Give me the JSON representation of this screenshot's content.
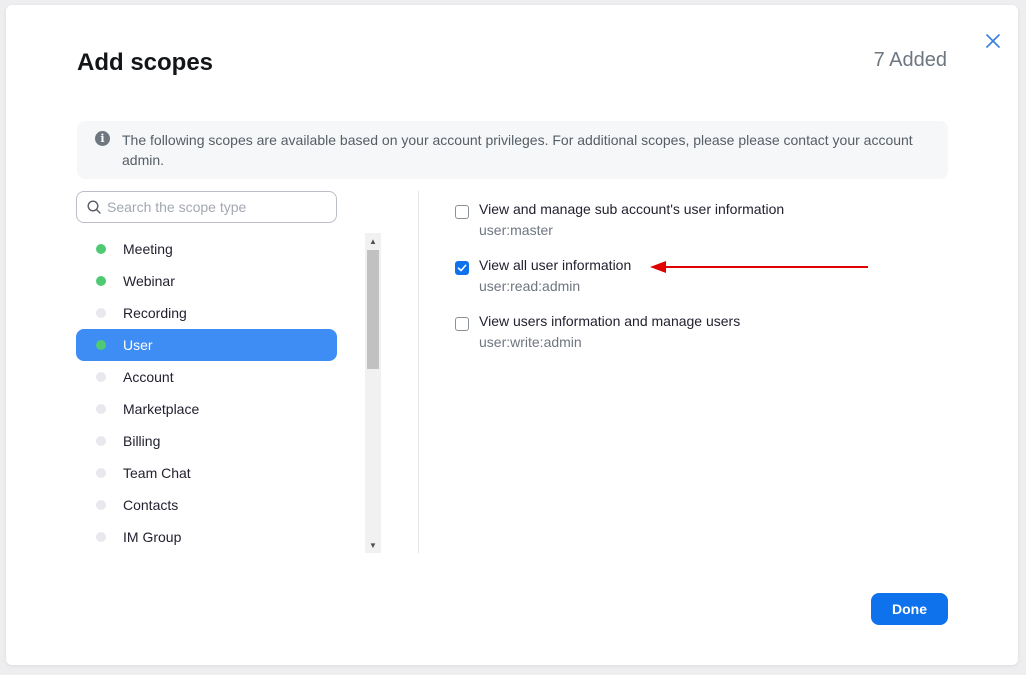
{
  "dialog": {
    "title": "Add scopes",
    "added_count": "7 Added",
    "info_text": "The following scopes are available based on your account privileges. For additional scopes, please please contact your account admin.",
    "search_placeholder": "Search the scope type",
    "done_label": "Done"
  },
  "categories": [
    {
      "label": "Meeting",
      "has_scopes": true,
      "active": false
    },
    {
      "label": "Webinar",
      "has_scopes": true,
      "active": false
    },
    {
      "label": "Recording",
      "has_scopes": false,
      "active": false
    },
    {
      "label": "User",
      "has_scopes": true,
      "active": true
    },
    {
      "label": "Account",
      "has_scopes": false,
      "active": false
    },
    {
      "label": "Marketplace",
      "has_scopes": false,
      "active": false
    },
    {
      "label": "Billing",
      "has_scopes": false,
      "active": false
    },
    {
      "label": "Team Chat",
      "has_scopes": false,
      "active": false
    },
    {
      "label": "Contacts",
      "has_scopes": false,
      "active": false
    },
    {
      "label": "IM Group",
      "has_scopes": false,
      "active": false
    }
  ],
  "scopes": [
    {
      "title": "View and manage sub account's user information",
      "code": "user:master",
      "checked": false
    },
    {
      "title": "View all user information",
      "code": "user:read:admin",
      "checked": true
    },
    {
      "title": "View users information and manage users",
      "code": "user:write:admin",
      "checked": false
    }
  ],
  "colors": {
    "accent": "#0e72ed",
    "active_item": "#3d8df5",
    "dot_on": "#4fca73",
    "dot_off": "#e8e9ee",
    "annotation_arrow": "#e00000"
  },
  "icons": {
    "close": "close-icon",
    "info": "info-icon",
    "search": "search-icon",
    "check": "checkmark-icon"
  }
}
